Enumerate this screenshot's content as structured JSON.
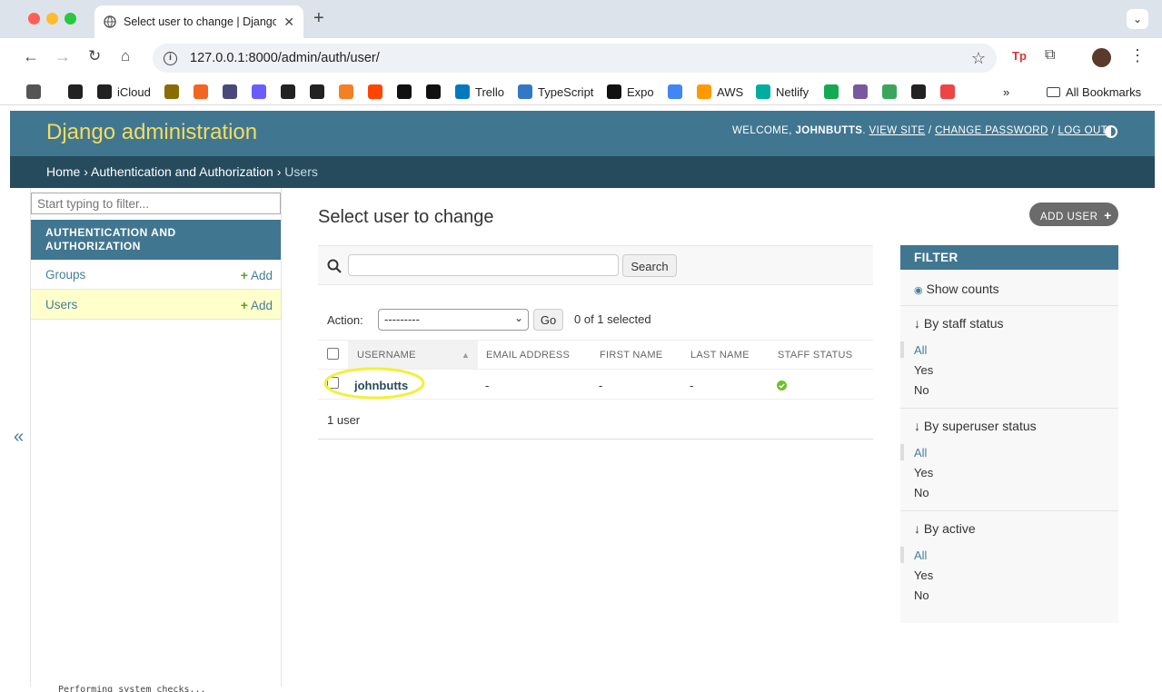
{
  "browser": {
    "tab_title": "Select user to change | Django",
    "url": "127.0.0.1:8000/admin/auth/user/",
    "bookmarks": [
      {
        "label": "",
        "icon": "apps-grid-icon",
        "color": "#555"
      },
      {
        "label": "",
        "icon": "apple-icon",
        "color": "#222"
      },
      {
        "label": "iCloud",
        "icon": "apple-icon",
        "color": "#222"
      },
      {
        "label": "",
        "icon": "ejs-icon",
        "color": "#8a6d00"
      },
      {
        "label": "",
        "icon": "y-combinator-icon",
        "color": "#f26522"
      },
      {
        "label": "",
        "icon": "mountain-icon",
        "color": "#4a4a7a"
      },
      {
        "label": "",
        "icon": "vercel-a-icon",
        "color": "#6b5cff"
      },
      {
        "label": "",
        "icon": "cf-icon",
        "color": "#222"
      },
      {
        "label": "",
        "icon": "github-icon",
        "color": "#222"
      },
      {
        "label": "",
        "icon": "stackoverflow-icon",
        "color": "#f48024"
      },
      {
        "label": "",
        "icon": "reddit-icon",
        "color": "#ff4500"
      },
      {
        "label": "",
        "icon": "medium-icon",
        "color": "#111"
      },
      {
        "label": "",
        "icon": "dev-icon",
        "color": "#111"
      },
      {
        "label": "Trello",
        "icon": "trello-icon",
        "color": "#0079bf"
      },
      {
        "label": "TypeScript",
        "icon": "typescript-icon",
        "color": "#3178c6"
      },
      {
        "label": "Expo",
        "icon": "expo-icon",
        "color": "#111"
      },
      {
        "label": "",
        "icon": "gcloud-icon",
        "color": "#4285f4"
      },
      {
        "label": "AWS",
        "icon": "aws-icon",
        "color": "#ff9900"
      },
      {
        "label": "Netlify",
        "icon": "netlify-icon",
        "color": "#00ad9f"
      },
      {
        "label": "",
        "icon": "mongodb-icon",
        "color": "#13aa52"
      },
      {
        "label": "",
        "icon": "heroku-icon",
        "color": "#79589f"
      },
      {
        "label": "",
        "icon": "w-icon",
        "color": "#3ba55c"
      },
      {
        "label": "",
        "icon": "m-icon",
        "color": "#222"
      },
      {
        "label": "",
        "icon": "color-wheel-icon",
        "color": "#e44"
      }
    ],
    "all_bookmarks": "All Bookmarks"
  },
  "header": {
    "brand": "Django administration",
    "welcome": "WELCOME,",
    "username": "JOHNBUTTS",
    "view_site": "VIEW SITE",
    "change_password": "CHANGE PASSWORD",
    "log_out": "LOG OUT"
  },
  "breadcrumbs": {
    "home": "Home",
    "app": "Authentication and Authorization",
    "current": "Users"
  },
  "sidebar": {
    "filter_placeholder": "Start typing to filter...",
    "app_caption": "AUTHENTICATION AND AUTHORIZATION",
    "models": [
      {
        "label": "Groups",
        "add": "Add"
      },
      {
        "label": "Users",
        "add": "Add"
      }
    ],
    "collapse": "«"
  },
  "main": {
    "title": "Select user to change",
    "add_button": "ADD USER",
    "search_button": "Search",
    "action_label": "Action:",
    "action_value": "---------",
    "go_button": "Go",
    "selected_count": "0 of 1 selected",
    "columns": [
      "USERNAME",
      "EMAIL ADDRESS",
      "FIRST NAME",
      "LAST NAME",
      "STAFF STATUS"
    ],
    "rows": [
      {
        "username": "johnbutts",
        "email": "-",
        "first_name": "-",
        "last_name": "-",
        "staff_status": "yes"
      }
    ],
    "paginator": "1 user"
  },
  "filter": {
    "title": "FILTER",
    "show_counts": "Show counts",
    "groups": [
      {
        "title": "By staff status",
        "options": [
          "All",
          "Yes",
          "No"
        ]
      },
      {
        "title": "By superuser status",
        "options": [
          "All",
          "Yes",
          "No"
        ]
      },
      {
        "title": "By active",
        "options": [
          "All",
          "Yes",
          "No"
        ]
      }
    ]
  },
  "terminal_text": "Performing system checks..."
}
